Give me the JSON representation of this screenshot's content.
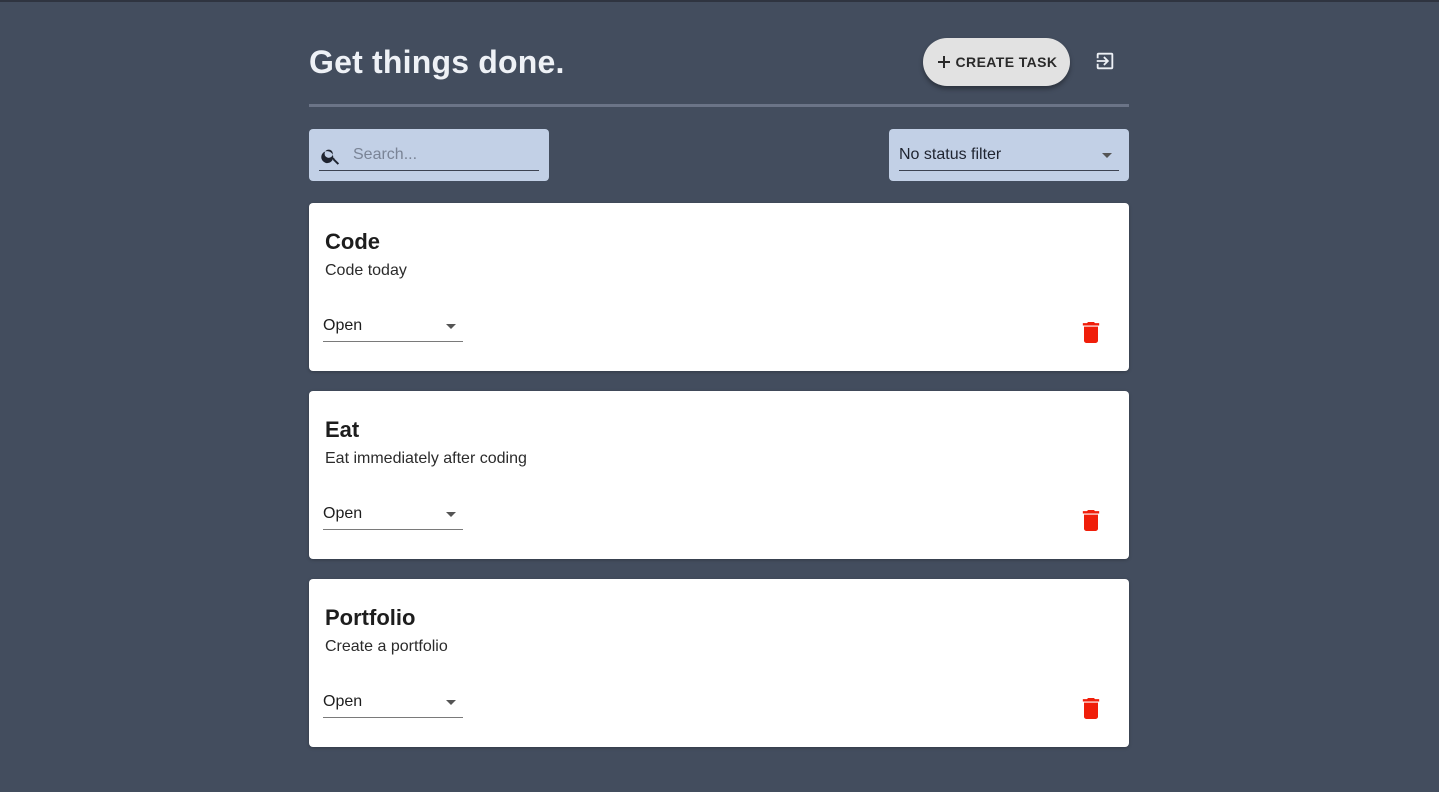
{
  "header": {
    "title": "Get things done.",
    "create_button_label": "CREATE TASK",
    "create_icon": "plus-icon",
    "logout_icon": "logout-icon"
  },
  "controls": {
    "search_placeholder": "Search...",
    "search_value": "",
    "search_icon": "search-icon",
    "status_filter_value": "No status filter"
  },
  "tasks": [
    {
      "title": "Code",
      "description": "Code today",
      "status": "Open"
    },
    {
      "title": "Eat",
      "description": "Eat immediately after coding",
      "status": "Open"
    },
    {
      "title": "Portfolio",
      "description": "Create a portfolio",
      "status": "Open"
    }
  ],
  "colors": {
    "background": "#434d5e",
    "field_background": "#c2d0e6",
    "delete_icon": "#f01e0a",
    "card": "#ffffff"
  }
}
